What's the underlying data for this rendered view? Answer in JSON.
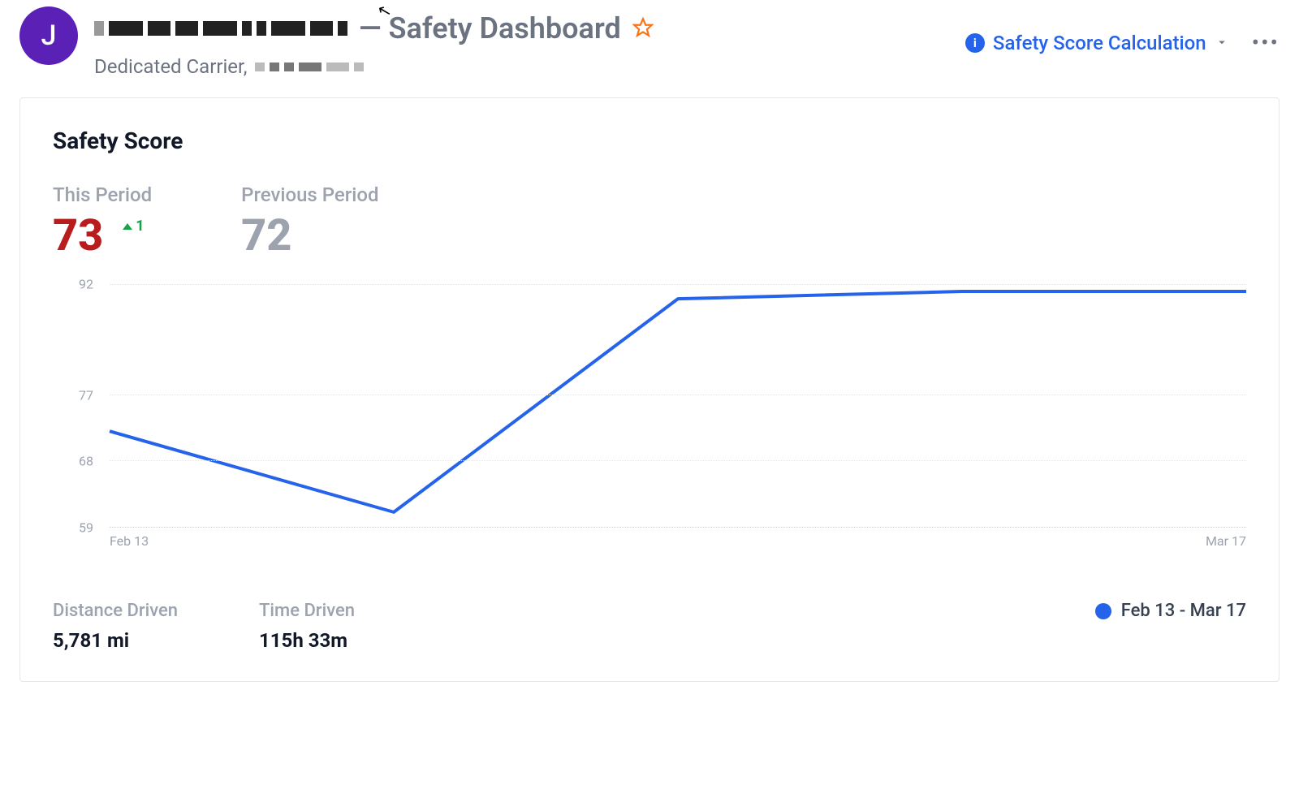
{
  "header": {
    "avatar_initial": "J",
    "title_suffix": "— Safety Dashboard",
    "subtitle_prefix": "Dedicated Carrier,",
    "calc_link_label": "Safety Score Calculation"
  },
  "card": {
    "title": "Safety Score",
    "this_period": {
      "label": "This Period",
      "value": "73",
      "delta": "1"
    },
    "previous_period": {
      "label": "Previous Period",
      "value": "72"
    },
    "distance": {
      "label": "Distance Driven",
      "value": "5,781 mi"
    },
    "time": {
      "label": "Time Driven",
      "value": "115h 33m"
    },
    "legend": {
      "range": "Feb 13 - Mar 17"
    }
  },
  "chart_data": {
    "type": "line",
    "title": "Safety Score",
    "xlabel": "",
    "ylabel": "",
    "ylim": [
      59,
      92
    ],
    "y_ticks": [
      59,
      68,
      77,
      92
    ],
    "x_ticks": [
      "Feb 13",
      "Mar 17"
    ],
    "series": [
      {
        "name": "Feb 13 - Mar 17",
        "color": "#2563eb",
        "x_index": [
          0,
          1,
          2,
          3,
          4
        ],
        "values": [
          72,
          61,
          90,
          91,
          91
        ]
      }
    ]
  }
}
